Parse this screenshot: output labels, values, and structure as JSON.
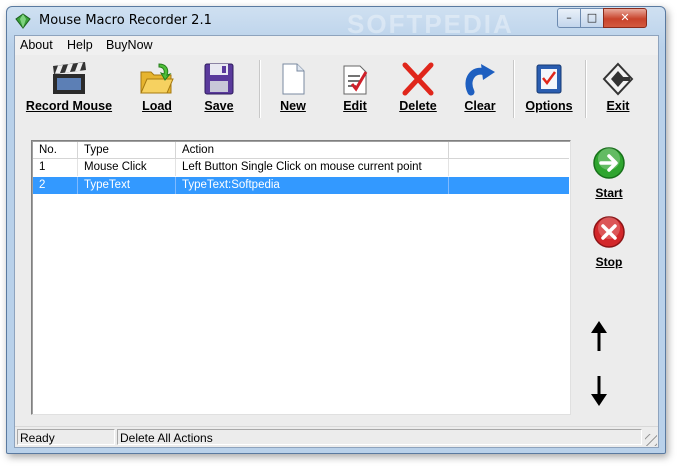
{
  "window": {
    "title": "Mouse Macro Recorder 2.1",
    "watermark": "SOFTPEDIA",
    "controls": {
      "minimize": "–",
      "maximize": "□",
      "close": "✕"
    }
  },
  "menu": {
    "items": [
      {
        "label": "About"
      },
      {
        "label": "Help"
      },
      {
        "label": "BuyNow"
      }
    ]
  },
  "toolbar": {
    "buttons": [
      {
        "label": "Record Mouse",
        "icon": "clapperboard-icon"
      },
      {
        "label": "Load",
        "icon": "folder-open-icon"
      },
      {
        "label": "Save",
        "icon": "floppy-disk-icon"
      },
      {
        "label": "New",
        "icon": "blank-document-icon"
      },
      {
        "label": "Edit",
        "icon": "edit-document-icon"
      },
      {
        "label": "Delete",
        "icon": "red-x-icon"
      },
      {
        "label": "Clear",
        "icon": "blue-curved-arrow-icon"
      },
      {
        "label": "Options",
        "icon": "checklist-icon"
      },
      {
        "label": "Exit",
        "icon": "exit-icon"
      }
    ]
  },
  "list": {
    "columns": [
      "No.",
      "Type",
      "Action"
    ],
    "rows": [
      {
        "no": "1",
        "type": "Mouse Click",
        "action": "Left Button Single Click on mouse current point",
        "selected": false
      },
      {
        "no": "2",
        "type": "TypeText",
        "action": "TypeText:Softpedia",
        "selected": true
      }
    ]
  },
  "side": {
    "start_label": "Start",
    "stop_label": "Stop",
    "move_up_icon": "up-arrow-icon",
    "move_down_icon": "down-arrow-icon"
  },
  "status": {
    "left": "Ready",
    "right": "Delete All Actions"
  },
  "colors": {
    "selection": "#3399ff",
    "start_green": "#2fa52f",
    "stop_red": "#d3272a"
  }
}
